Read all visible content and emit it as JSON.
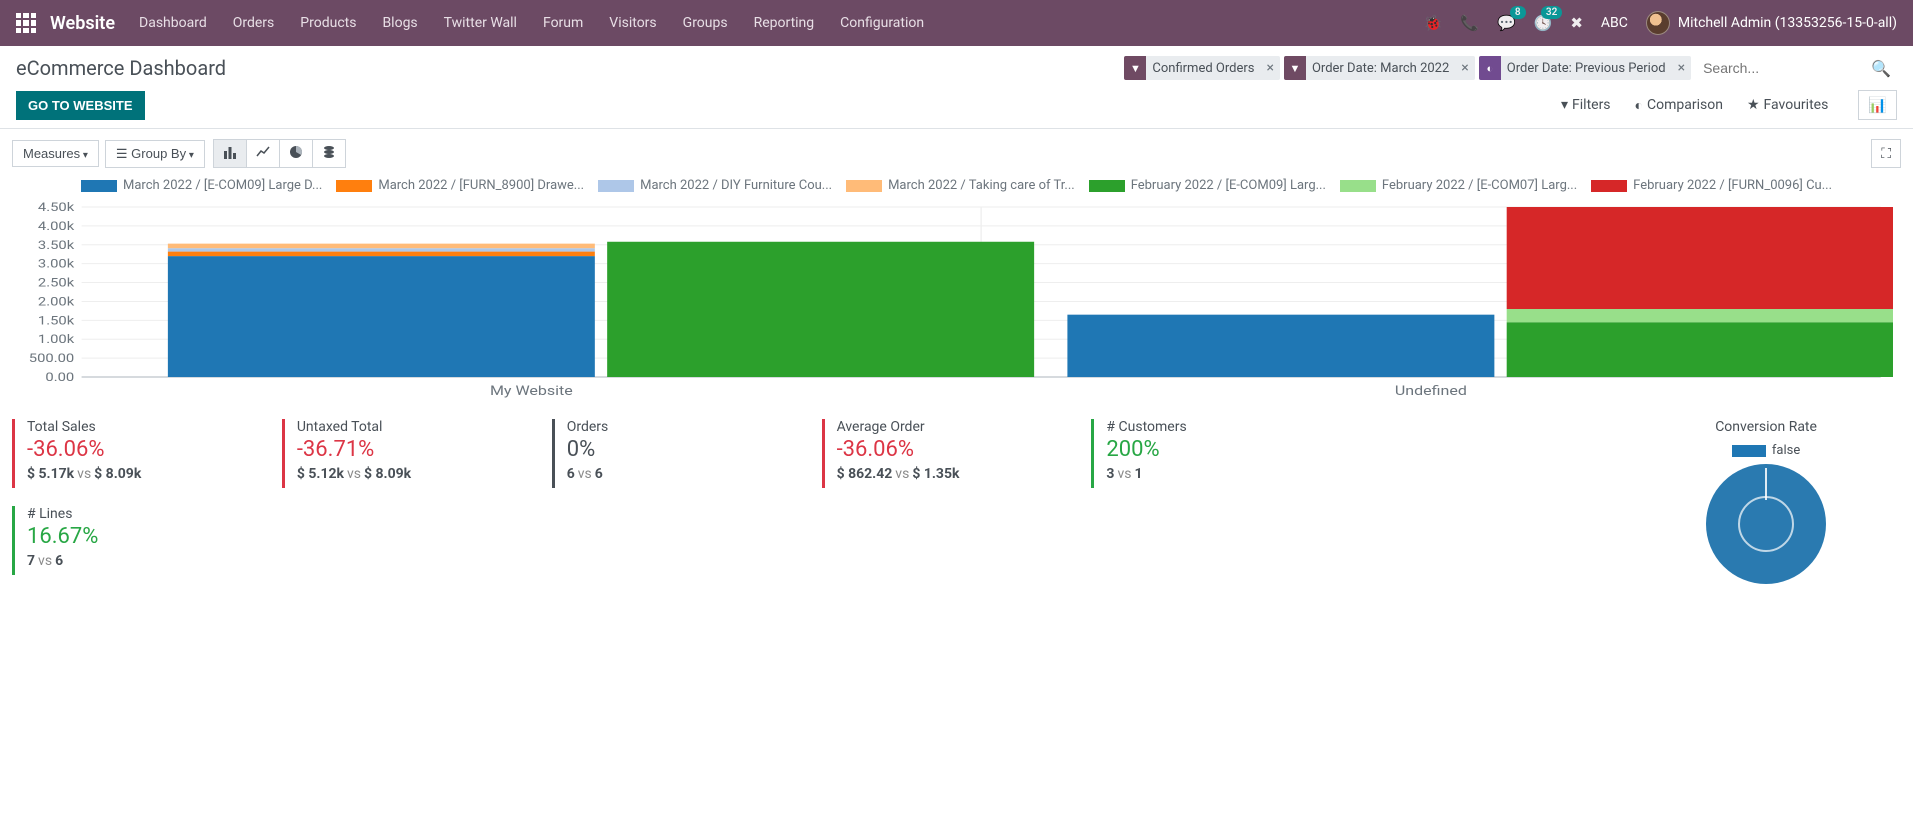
{
  "nav": {
    "brand": "Website",
    "menu": [
      "Dashboard",
      "Orders",
      "Products",
      "Blogs",
      "Twitter Wall",
      "Forum",
      "Visitors",
      "Groups",
      "Reporting",
      "Configuration"
    ],
    "messages_badge": "8",
    "activities_badge": "32",
    "db": "ABC",
    "user": "Mitchell Admin (13353256-15-0-all)"
  },
  "cp": {
    "title": "eCommerce Dashboard",
    "go_to_website": "GO TO WEBSITE",
    "facets": [
      {
        "icon": "▼",
        "label": "Confirmed Orders"
      },
      {
        "icon": "▼",
        "label": "Order Date: March 2022"
      },
      {
        "icon": "◐",
        "label": "Order Date: Previous Period"
      }
    ],
    "search_placeholder": "Search...",
    "filters": "Filters",
    "comparison": "Comparison",
    "favourites": "Favourites"
  },
  "toolbar": {
    "measures": "Measures",
    "groupby": "Group By"
  },
  "legend": [
    {
      "color": "#1f77b4",
      "label": "March 2022 / [E-COM09] Large D..."
    },
    {
      "color": "#ff7f0e",
      "label": "March 2022 / [FURN_8900] Drawe..."
    },
    {
      "color": "#aec7e8",
      "label": "March 2022 / DIY Furniture Cou..."
    },
    {
      "color": "#ffbb78",
      "label": "March 2022 / Taking care of Tr..."
    },
    {
      "color": "#2ca02c",
      "label": "February 2022 / [E-COM09] Larg..."
    },
    {
      "color": "#98df8a",
      "label": "February 2022 / [E-COM07] Larg..."
    },
    {
      "color": "#d62728",
      "label": "February 2022 / [FURN_0096] Cu..."
    }
  ],
  "chart_data": {
    "type": "bar",
    "stacked": true,
    "categories": [
      "My Website",
      "Undefined"
    ],
    "y_ticks": [
      "0.00",
      "500.00",
      "1.00k",
      "1.50k",
      "2.00k",
      "2.50k",
      "3.00k",
      "3.50k",
      "4.00k",
      "4.50k"
    ],
    "ylim": [
      0,
      4500
    ],
    "groups": [
      {
        "name": "March 2022",
        "stacks": [
          {
            "category": "My Website",
            "segments": [
              {
                "series": "March 2022 / [E-COM09] Large D...",
                "color": "#1f77b4",
                "value": 3200
              },
              {
                "series": "March 2022 / [FURN_8900] Drawe...",
                "color": "#ff7f0e",
                "value": 120
              },
              {
                "series": "March 2022 / DIY Furniture Cou...",
                "color": "#aec7e8",
                "value": 90
              },
              {
                "series": "March 2022 / Taking care of Tr...",
                "color": "#ffbb78",
                "value": 120
              }
            ]
          },
          {
            "category": "Undefined",
            "segments": [
              {
                "series": "March 2022 / [E-COM09] Large D...",
                "color": "#1f77b4",
                "value": 1650
              }
            ]
          }
        ]
      },
      {
        "name": "February 2022",
        "stacks": [
          {
            "category": "My Website",
            "segments": [
              {
                "series": "February 2022 / [E-COM09] Larg...",
                "color": "#2ca02c",
                "value": 3580
              }
            ]
          },
          {
            "category": "Undefined",
            "segments": [
              {
                "series": "February 2022 / [E-COM09] Larg...",
                "color": "#2ca02c",
                "value": 1450
              },
              {
                "series": "February 2022 / [E-COM07] Larg...",
                "color": "#98df8a",
                "value": 350
              },
              {
                "series": "February 2022 / [FURN_0096] Cu...",
                "color": "#d62728",
                "value": 2700
              }
            ]
          }
        ]
      }
    ]
  },
  "kpis": [
    {
      "label": "Total Sales",
      "value": "-36.06%",
      "trend": "neg",
      "left": "$ 5.17k",
      "right": "$ 8.09k"
    },
    {
      "label": "Untaxed Total",
      "value": "-36.71%",
      "trend": "neg",
      "left": "$ 5.12k",
      "right": "$ 8.09k"
    },
    {
      "label": "Orders",
      "value": "0%",
      "trend": "neutral",
      "left": "6",
      "right": "6"
    },
    {
      "label": "Average Order",
      "value": "-36.06%",
      "trend": "neg",
      "left": "$ 862.42",
      "right": "$ 1.35k"
    },
    {
      "label": "# Customers",
      "value": "200%",
      "trend": "pos",
      "left": "3",
      "right": "1"
    }
  ],
  "kpi_lines": {
    "label": "# Lines",
    "value": "16.67%",
    "trend": "pos",
    "left": "7",
    "right": "6"
  },
  "conversion": {
    "title": "Conversion Rate",
    "legend": "false"
  },
  "vs_label": "vs"
}
